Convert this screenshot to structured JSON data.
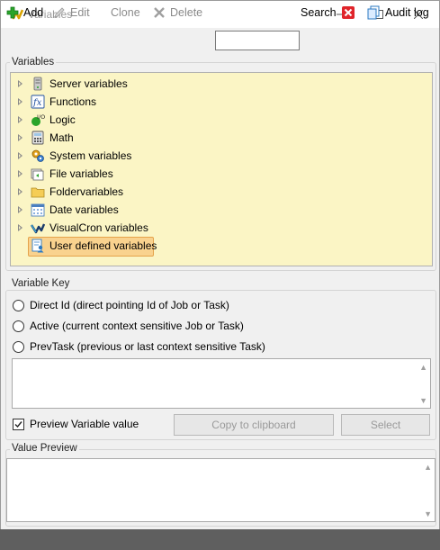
{
  "window": {
    "title": "Variables"
  },
  "toolbar": {
    "add": "Add",
    "edit": "Edit",
    "clone": "Clone",
    "delete": "Delete",
    "search_value": "",
    "search": "Search",
    "audit_log": "Audit log"
  },
  "variables_group": {
    "label": "Variables",
    "items": [
      {
        "label": "Server variables",
        "icon": "server-icon"
      },
      {
        "label": "Functions",
        "icon": "function-icon"
      },
      {
        "label": "Logic",
        "icon": "logic-icon"
      },
      {
        "label": "Math",
        "icon": "calculator-icon"
      },
      {
        "label": "System variables",
        "icon": "system-gear-icon"
      },
      {
        "label": "File variables",
        "icon": "file-icon"
      },
      {
        "label": "Foldervariables",
        "icon": "folder-icon"
      },
      {
        "label": "Date variables",
        "icon": "calendar-icon"
      },
      {
        "label": "VisualCron variables",
        "icon": "visualcron-icon"
      },
      {
        "label": "User defined variables",
        "icon": "user-variable-icon",
        "selected": true
      }
    ]
  },
  "variable_key": {
    "label": "Variable Key",
    "options": [
      "Direct Id (direct pointing Id of Job or Task)",
      "Active (current context sensitive Job or Task)",
      "PrevTask (previous or last context sensitive Task)"
    ],
    "key_text": "",
    "preview_checkbox": "Preview Variable value",
    "preview_checked": true,
    "copy_button": "Copy to clipboard",
    "select_button": "Select"
  },
  "value_preview": {
    "label": "Value Preview",
    "text": ""
  },
  "colors": {
    "tree_background": "#fbf5c5",
    "selection": "#f9d28e",
    "delete_red": "#e0242a",
    "add_green": "#2aa52a"
  }
}
